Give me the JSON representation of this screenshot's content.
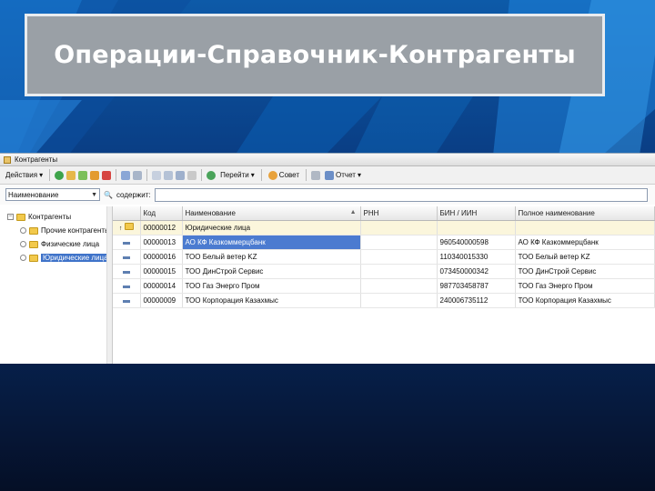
{
  "slide": {
    "title": "Операции-Справочник-Контрагенты"
  },
  "window": {
    "title": "Контрагенты",
    "toolbar": {
      "actions_label": "Действия",
      "go_label": "Перейти",
      "advice_label": "Совет",
      "report_label": "Отчет"
    },
    "filter": {
      "selected": "Наименование",
      "mode_label": "содержит:",
      "value": ""
    },
    "tree": [
      {
        "label": "Контрагенты",
        "level": 0
      },
      {
        "label": "Прочие контрагенты",
        "level": 1
      },
      {
        "label": "Физические лица",
        "level": 1
      },
      {
        "label": "Юридические лица",
        "level": 1,
        "selected": true
      }
    ],
    "columns": [
      "Код",
      "Наименование",
      "РНН",
      "БИН / ИИН",
      "Полное наименование"
    ],
    "group_row": {
      "code": "00000012",
      "name": "Юридические лица"
    },
    "rows": [
      {
        "code": "00000013",
        "name": "АО КФ Казкоммерцбанк",
        "rnn": "",
        "bin": "960540000598",
        "full_name": "АО КФ Казкоммерцбанк"
      },
      {
        "code": "00000016",
        "name": "ТОО Белый ветер KZ",
        "rnn": "",
        "bin": "110340015330",
        "full_name": "ТОО Белый ветер KZ"
      },
      {
        "code": "00000015",
        "name": "ТОО ДинСтрой Сервис",
        "rnn": "",
        "bin": "073450000342",
        "full_name": "ТОО ДинСтрой Сервис"
      },
      {
        "code": "00000014",
        "name": "ТОО Газ Энерго Пром",
        "rnn": "",
        "bin": "987703458787",
        "full_name": "ТОО Газ Энерго Пром"
      },
      {
        "code": "00000009",
        "name": "ТОО Корпорация Казахмыс",
        "rnn": "",
        "bin": "240006735112",
        "full_name": "ТОО Корпорация Казахмыс"
      }
    ]
  }
}
